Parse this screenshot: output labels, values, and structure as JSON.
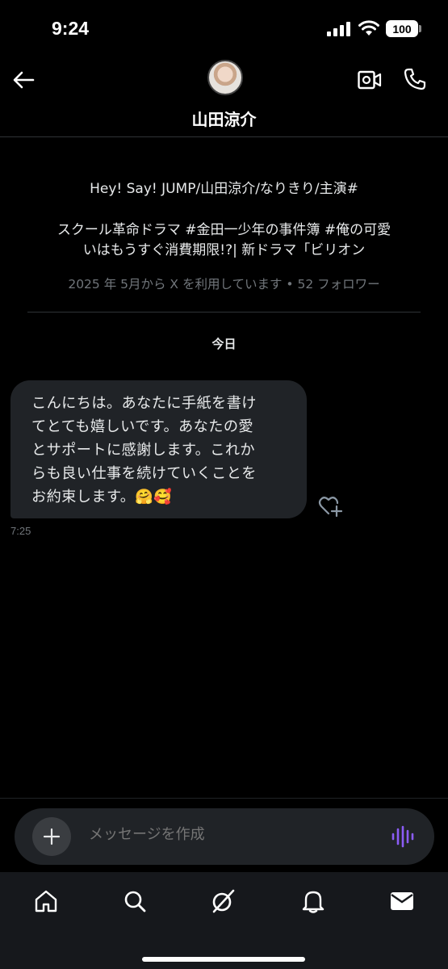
{
  "status_bar": {
    "time": "9:24",
    "battery": "100"
  },
  "header": {
    "contact_name": "山田涼介",
    "icons": [
      "back-arrow-icon",
      "avatar",
      "video-call-icon",
      "phone-icon"
    ]
  },
  "profile": {
    "bio_line1": "Hey! Say! JUMP/山田涼介/なりきり/主演#",
    "bio_line2": "スクール革命ドラマ #金田一少年の事件簿 #俺の可愛",
    "bio_line3": "いはもうすぐ消費期限!?| 新ドラマ「ビリオン",
    "meta": "2025 年 5月から X を利用しています • 52 フォロワー"
  },
  "conversation": {
    "date_separator": "今日",
    "messages": [
      {
        "lines": [
          "こんにちは。あなたに手紙を書け",
          "てとても嬉しいです。あなたの愛",
          "とサポートに感謝します。これか",
          "らも良い仕事を続けていくことを",
          "お約束します。🤗🥰"
        ],
        "time": "7:25"
      }
    ]
  },
  "composer": {
    "placeholder": "メッセージを作成"
  },
  "tab_bar": {
    "tabs": [
      "home-icon",
      "search-icon",
      "grok-icon",
      "notifications-icon",
      "messages-icon"
    ]
  },
  "colors": {
    "background": "#000000",
    "bubble": "#202327",
    "muted_text": "#71767b",
    "voice_accent": "#8b5cf6"
  }
}
